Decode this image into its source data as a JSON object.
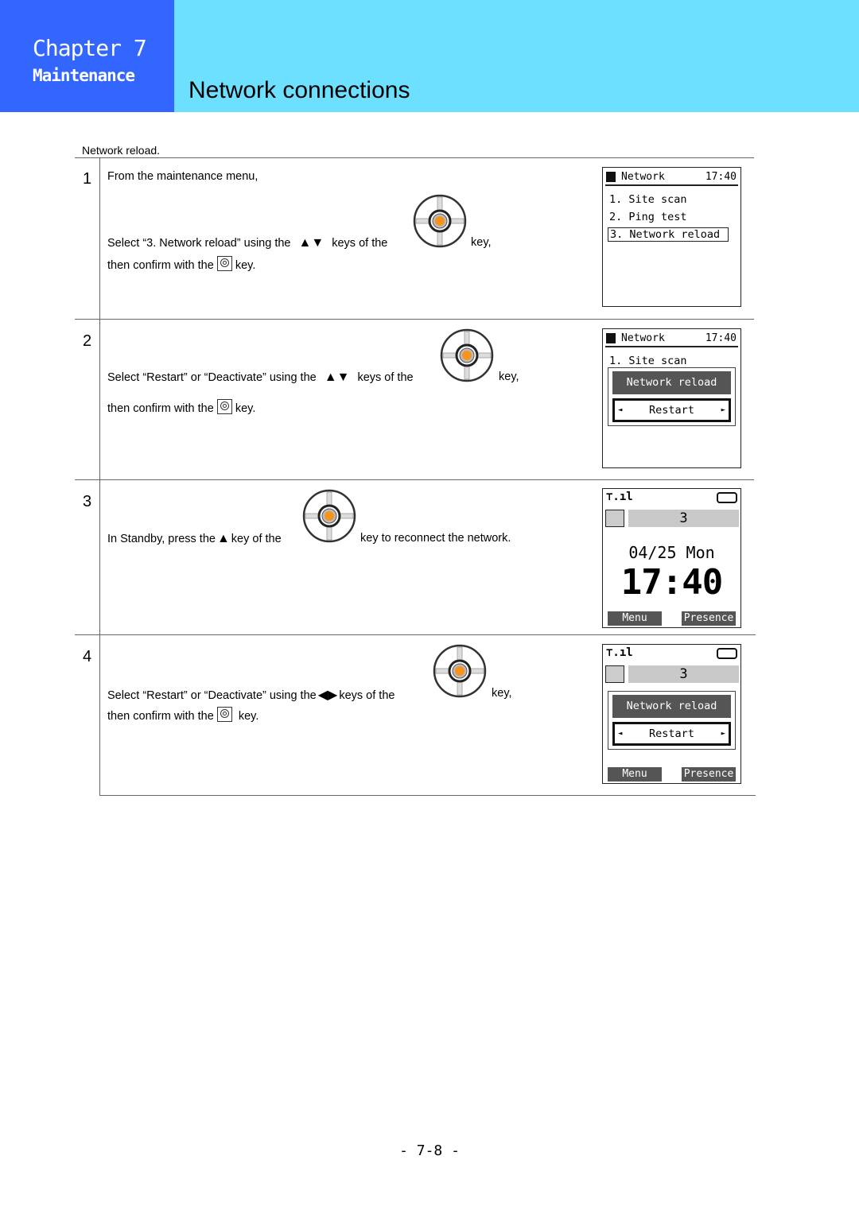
{
  "header": {
    "chapter": "Chapter 7",
    "section": "Maintenance",
    "title": "Network connections",
    "colors": {
      "chapter_bg": "#3366ff",
      "title_bg": "#6ddfff"
    }
  },
  "intro": "Network reload.",
  "steps": [
    {
      "number": "1",
      "line1": "From the maintenance menu,",
      "line2_a": "Select “3. Network reload” using the",
      "arrows": "▲▼",
      "line2_b": "keys of the",
      "line2_c": "key,",
      "line3_a": "then confirm with the",
      "line3_b": "key.",
      "screen": {
        "header": "Network",
        "clock": "17:40",
        "items": [
          "1. Site scan",
          "2. Ping test",
          "3. Network reload"
        ],
        "selected_index": 2
      }
    },
    {
      "number": "2",
      "line2_a": "Select “Restart” or “Deactivate” using the",
      "arrows": "▲▼",
      "line2_b": "keys of the",
      "line2_c": "key,",
      "line3_a": "then confirm with the",
      "line3_b": "key.",
      "screen": {
        "header": "Network",
        "clock": "17:40",
        "items": [
          "1. Site scan"
        ],
        "dialog_title": "Network reload",
        "dialog_value": "Restart"
      }
    },
    {
      "number": "3",
      "line2_a": "In Standby, press the",
      "arrows": "▲",
      "line2_b": "key of the",
      "line2_c": "key to reconnect the network.",
      "screen": {
        "status_num": "3",
        "date": "04/25 Mon",
        "time": "17:40",
        "soft_left": "Menu",
        "soft_right": "Presence"
      }
    },
    {
      "number": "4",
      "line2_a": "Select “Restart” or “Deactivate” using the",
      "arrows": "◀▶",
      "line2_b": "keys of the",
      "line2_c": "key,",
      "line3_a": "then confirm with the",
      "line3_b": "key.",
      "screen": {
        "status_num": "3",
        "dialog_title": "Network reload",
        "dialog_value": "Restart",
        "soft_left": "Menu",
        "soft_right": "Presence"
      }
    }
  ],
  "icons": {
    "nav": "navigation-key-icon",
    "ok": "ok-key-icon",
    "left": "◄",
    "right": "►"
  },
  "page_number": "- 7-8 -"
}
